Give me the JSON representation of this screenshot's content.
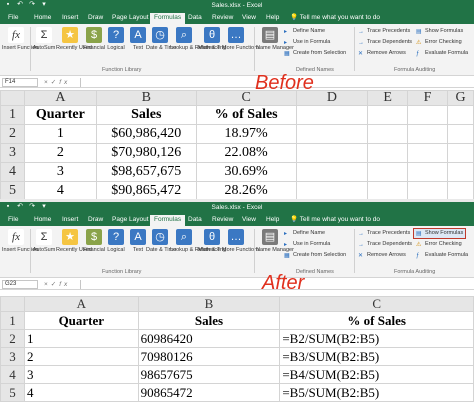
{
  "colors": {
    "excel_green": "#217346",
    "caption_red": "#e0301e",
    "highlight_box": "#c0392b"
  },
  "window": {
    "title": "Sales.xlsx  -  Excel",
    "quick_access_icons": [
      "save-icon",
      "undo-icon",
      "redo-icon",
      "customize-icon"
    ]
  },
  "tabs": [
    "File",
    "Home",
    "Insert",
    "Draw",
    "Page Layout",
    "Formulas",
    "Data",
    "Review",
    "View",
    "Help"
  ],
  "active_tab": "Formulas",
  "tell_me": "Tell me what you want to do",
  "ribbon": {
    "insert_function": "Insert Function",
    "autosum": "AutoSum",
    "recently_used": "Recently Used",
    "financial": "Financial",
    "logical": "Logical",
    "text": "Text",
    "date_time": "Date & Time",
    "lookup_reference": "Lookup & Reference",
    "math_trig": "Math & Trig",
    "more_functions": "More Functions",
    "function_library": "Function Library",
    "name_manager": "Name Manager",
    "define_name": "Define Name",
    "use_in_formula": "Use in Formula",
    "create_from_selection": "Create from Selection",
    "defined_names": "Defined Names",
    "trace_precedents": "Trace Precedents",
    "trace_dependents": "Trace Dependents",
    "remove_arrows": "Remove Arrows",
    "show_formulas": "Show Formulas",
    "error_checking": "Error Checking",
    "evaluate_formula": "Evaluate Formula",
    "formula_auditing": "Formula Auditing"
  },
  "before": {
    "caption": "Before",
    "name_box": "F14",
    "columns": [
      "A",
      "B",
      "C",
      "D",
      "E",
      "F",
      "G"
    ],
    "rows": [
      {
        "num": "1",
        "a": "Quarter",
        "b": "Sales",
        "c": "% of Sales"
      },
      {
        "num": "2",
        "a": "1",
        "b": "$60,986,420",
        "c": "18.97%"
      },
      {
        "num": "3",
        "a": "2",
        "b": "$70,980,126",
        "c": "22.08%"
      },
      {
        "num": "4",
        "a": "3",
        "b": "$98,657,675",
        "c": "30.69%"
      },
      {
        "num": "5",
        "a": "4",
        "b": "$90,865,472",
        "c": "28.26%"
      }
    ]
  },
  "after": {
    "caption": "After",
    "name_box": "G23",
    "columns": [
      "A",
      "B",
      "C"
    ],
    "rows": [
      {
        "num": "1",
        "a": "Quarter",
        "b": "Sales",
        "c": "% of Sales"
      },
      {
        "num": "2",
        "a": "1",
        "b": "60986420",
        "c": "=B2/SUM(B2:B5)"
      },
      {
        "num": "3",
        "a": "2",
        "b": "70980126",
        "c": "=B3/SUM(B2:B5)"
      },
      {
        "num": "4",
        "a": "3",
        "b": "98657675",
        "c": "=B4/SUM(B2:B5)"
      },
      {
        "num": "5",
        "a": "4",
        "b": "90865472",
        "c": "=B5/SUM(B2:B5)"
      }
    ]
  }
}
